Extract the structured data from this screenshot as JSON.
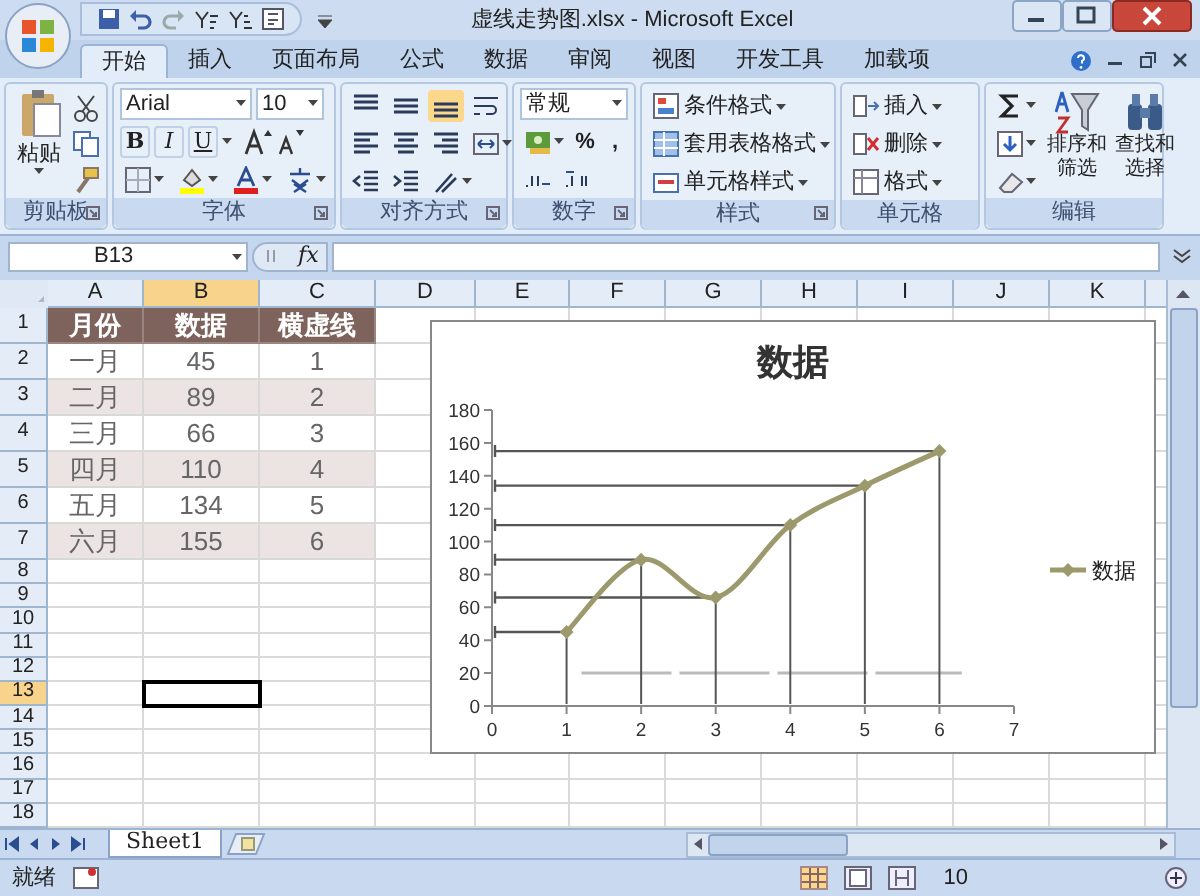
{
  "window": {
    "title": "虚线走势图.xlsx - Microsoft Excel"
  },
  "tabs": [
    {
      "label": "开始",
      "selected": true
    },
    {
      "label": "插入",
      "selected": false
    },
    {
      "label": "页面布局",
      "selected": false
    },
    {
      "label": "公式",
      "selected": false
    },
    {
      "label": "数据",
      "selected": false
    },
    {
      "label": "审阅",
      "selected": false
    },
    {
      "label": "视图",
      "selected": false
    },
    {
      "label": "开发工具",
      "selected": false
    },
    {
      "label": "加载项",
      "selected": false
    }
  ],
  "ribbon": {
    "groups": [
      {
        "kind": "clipboard",
        "label": "剪贴板",
        "buttons": [
          "粘贴"
        ]
      },
      {
        "kind": "font",
        "label": "字体",
        "font_name": "Arial",
        "font_size": "10",
        "style_buttons": [
          "B",
          "I",
          "U"
        ]
      },
      {
        "kind": "align",
        "label": "对齐方式"
      },
      {
        "kind": "number",
        "label": "数字",
        "format": "常规",
        "number_buttons": [
          "%",
          ","
        ]
      },
      {
        "kind": "list",
        "label": "样式",
        "buttons": [
          "条件格式",
          "套用表格格式",
          "单元格样式"
        ]
      },
      {
        "kind": "list",
        "label": "单元格",
        "buttons": [
          "插入",
          "删除",
          "格式"
        ]
      },
      {
        "kind": "editing",
        "label": "编辑",
        "buttons": [
          "排序和筛选",
          "查找和选择"
        ]
      }
    ]
  },
  "formula_bar": {
    "name_box": "B13",
    "function_label": "fx"
  },
  "sheet": {
    "columns": [
      {
        "label": "A",
        "selected": false
      },
      {
        "label": "B",
        "selected": true
      },
      {
        "label": "C",
        "selected": false
      },
      {
        "label": "D",
        "selected": false
      },
      {
        "label": "E",
        "selected": false
      },
      {
        "label": "F",
        "selected": false
      },
      {
        "label": "G",
        "selected": false
      },
      {
        "label": "H",
        "selected": false
      },
      {
        "label": "I",
        "selected": false
      },
      {
        "label": "J",
        "selected": false
      },
      {
        "label": "K",
        "selected": false
      }
    ],
    "rows": [
      {
        "label": "1",
        "selected": false,
        "cells": [
          "月份",
          "数据",
          "横虚线"
        ]
      },
      {
        "label": "2",
        "selected": false,
        "cells": [
          "一月",
          "45",
          "1"
        ]
      },
      {
        "label": "3",
        "selected": false,
        "cells": [
          "二月",
          "89",
          "2"
        ]
      },
      {
        "label": "4",
        "selected": false,
        "cells": [
          "三月",
          "66",
          "3"
        ]
      },
      {
        "label": "5",
        "selected": false,
        "cells": [
          "四月",
          "110",
          "4"
        ]
      },
      {
        "label": "6",
        "selected": false,
        "cells": [
          "五月",
          "134",
          "5"
        ]
      },
      {
        "label": "7",
        "selected": false,
        "cells": [
          "六月",
          "155",
          "6"
        ]
      },
      {
        "label": "8",
        "selected": false,
        "cells": []
      },
      {
        "label": "9",
        "selected": false,
        "cells": []
      },
      {
        "label": "10",
        "selected": false,
        "cells": []
      },
      {
        "label": "11",
        "selected": false,
        "cells": []
      },
      {
        "label": "12",
        "selected": false,
        "cells": []
      },
      {
        "label": "13",
        "selected": true,
        "cells": []
      },
      {
        "label": "14",
        "selected": false,
        "cells": []
      },
      {
        "label": "15",
        "selected": false,
        "cells": []
      },
      {
        "label": "16",
        "selected": false,
        "cells": []
      },
      {
        "label": "17",
        "selected": false,
        "cells": []
      },
      {
        "label": "18",
        "selected": false,
        "cells": []
      }
    ]
  },
  "chart": {
    "chart_data": {
      "type": "line",
      "title": "数据",
      "x": [
        1,
        2,
        3,
        4,
        5,
        6
      ],
      "series": [
        {
          "name": "数据",
          "color": "#9c9a6c",
          "marker": "diamond",
          "values": [
            45,
            89,
            66,
            110,
            134,
            155
          ]
        }
      ],
      "xlim": [
        0,
        7
      ],
      "ylim": [
        0,
        180
      ],
      "xticks": [
        0,
        1,
        2,
        3,
        4,
        5,
        6,
        7
      ],
      "yticks": [
        0,
        20,
        40,
        60,
        80,
        100,
        120,
        140,
        160,
        180
      ],
      "ref_lines": [
        {
          "axis": "y",
          "value": 20
        },
        {
          "axis": "y",
          "value": 45
        },
        {
          "axis": "y",
          "value": 89
        },
        {
          "axis": "y",
          "value": 66
        },
        {
          "axis": "y",
          "value": 110
        },
        {
          "axis": "y",
          "value": 134
        },
        {
          "axis": "y",
          "value": 155
        },
        {
          "axis": "x",
          "value": 1
        },
        {
          "axis": "x",
          "value": 2
        },
        {
          "axis": "x",
          "value": 3
        },
        {
          "axis": "x",
          "value": 4
        },
        {
          "axis": "x",
          "value": 5
        },
        {
          "axis": "x",
          "value": 6
        }
      ]
    }
  },
  "sheet_tabs": [
    {
      "label": "Sheet1",
      "selected": true
    }
  ],
  "status_bar": {
    "status": "就绪",
    "zoom": "10"
  }
}
